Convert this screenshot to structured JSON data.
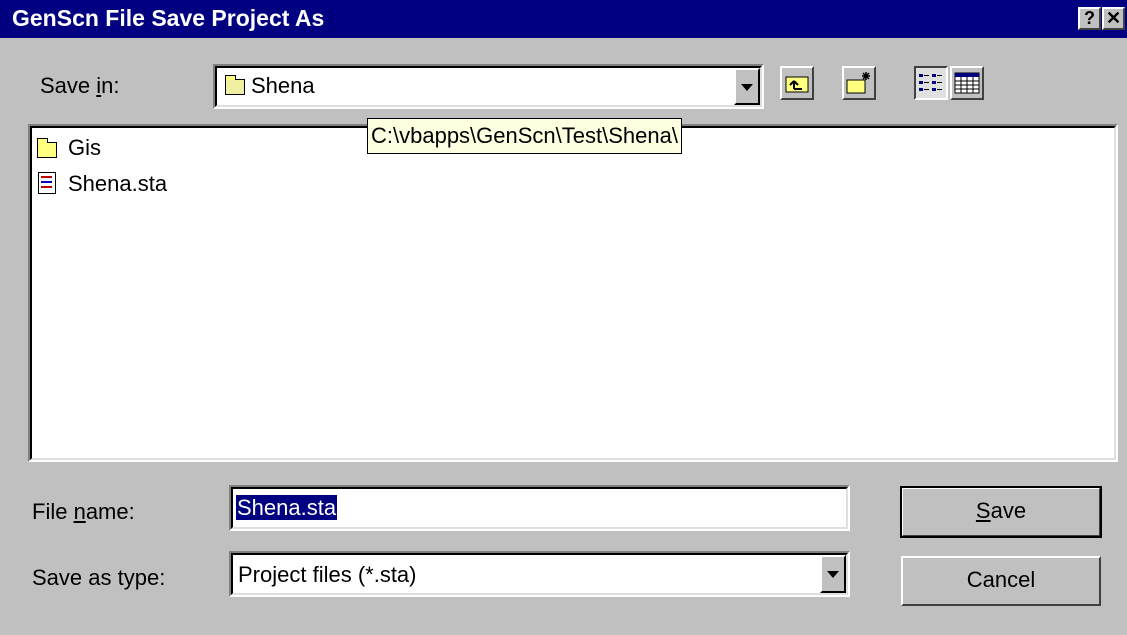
{
  "window": {
    "title": "GenScn File Save Project As",
    "help_label": "?",
    "close_label": "✕"
  },
  "save_in": {
    "label_pre": "Save ",
    "label_accel": "i",
    "label_post": "n:",
    "value": "Shena",
    "tooltip": "C:\\vbapps\\GenScn\\Test\\Shena\\"
  },
  "toolbar": {
    "up_icon": "up-folder-icon",
    "new_folder_icon": "new-folder-icon",
    "list_icon": "list-view-icon",
    "details_icon": "details-view-icon"
  },
  "files": [
    {
      "name": "Gis",
      "icon": "folder-icon"
    },
    {
      "name": "Shena.sta",
      "icon": "project-file-icon"
    }
  ],
  "file_name": {
    "label_pre": "File ",
    "label_accel": "n",
    "label_post": "ame:",
    "value": "Shena.sta"
  },
  "save_as_type": {
    "label": "Save as type:",
    "value": "Project files (*.sta)"
  },
  "buttons": {
    "save_accel": "S",
    "save_rest": "ave",
    "cancel": "Cancel"
  },
  "colors": {
    "title_bar": "#000080",
    "dialog_bg": "#c0c0c0",
    "tooltip_bg": "#ffffe1",
    "selection": "#000080"
  }
}
